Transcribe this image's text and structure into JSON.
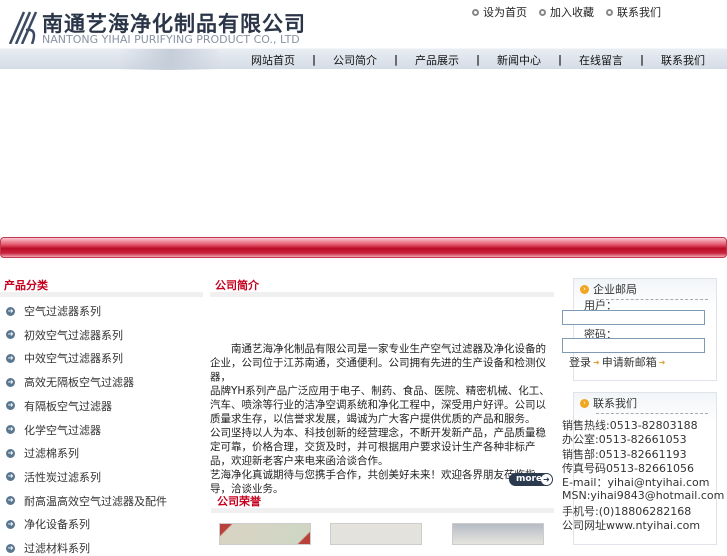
{
  "header": {
    "logo_cn": "南通艺海净化制品有限公司",
    "logo_en": "NANTONG YIHAI PURIFYING PRODUCT CO., LTD",
    "top_links": [
      "设为首页",
      "加入收藏",
      "联系我们"
    ]
  },
  "nav": [
    "网站首页",
    "公司简介",
    "产品展示",
    "新闻中心",
    "在线留言",
    "联系我们"
  ],
  "categories": {
    "title": "产品分类",
    "items": [
      "空气过滤器系列",
      "初效空气过滤器系列",
      "中效空气过滤器系列",
      "高效无隔板空气过滤器",
      "有隔板空气过滤器",
      "化学空气过滤器",
      "过滤棉系列",
      "活性炭过滤系列",
      "耐高温高效空气过滤器及配件",
      "净化设备系列",
      "过滤材料系列"
    ]
  },
  "intro": {
    "title": "公司简介",
    "paragraphs": [
      "　　南通艺海净化制品有限公司是一家专业生产空气过滤器及净化设备的企业，公司位于江苏南通，交通便利。公司拥有先进的生产设备和检测仪器，",
      "品牌YH系列产品广泛应用于电子、制药、食品、医院、精密机械、化工、汽车、喷涂等行业的洁净空调系统和净化工程中，深受用户好评。公司以质量求生存，以信誉求发展，竭诚为广大客户提供优质的产品和服务。",
      "公司坚持以人为本、科技创新的经营理念，不断开发新产品，产品质量稳定可靠，价格合理，交货及时，并可根据用户要求设计生产各种非标产品，欢迎新老客户来电来函洽谈合作。",
      "艺海净化真诚期待与您携手合作，共创美好未来！欢迎各界朋友莅临指导，洽谈业务。"
    ],
    "more": "more"
  },
  "honors": {
    "title": "公司荣誉"
  },
  "login": {
    "title": "企业邮局",
    "user_label": "用户：",
    "password_label": "密码：",
    "user_value": "",
    "password_value": "",
    "login_link": "登录",
    "register_link": "申请新邮箱"
  },
  "contact": {
    "title": "联系我们",
    "lines": [
      "销售热线:0513-82803188",
      "办公室:0513-82661053",
      "销售部:0513-82661193",
      "传真号码0513-82661056",
      "E-mail：yihai@ntyihai.com",
      "MSN:yihai9843@hotmail.com",
      "手机号:(0)18806282168",
      "公司网址www.ntyihai.com"
    ]
  }
}
